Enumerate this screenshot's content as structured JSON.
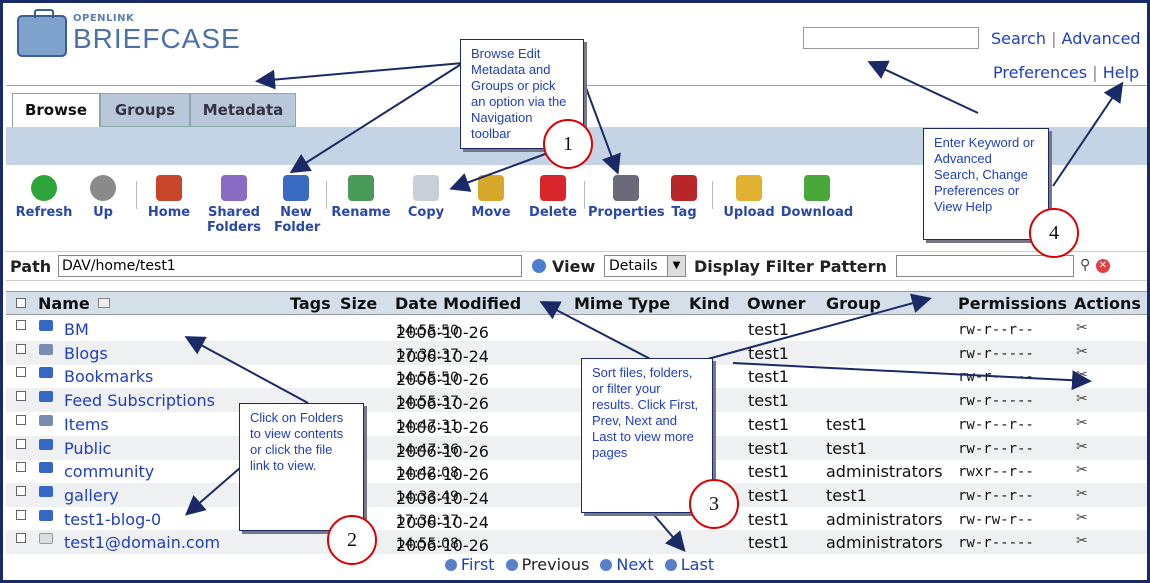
{
  "logo": {
    "line1": "OPENLINK",
    "line2": "BRIEFCASE"
  },
  "top_links": {
    "search": "Search",
    "sep": "|",
    "advanced": "Advanced",
    "preferences": "Preferences",
    "help": "Help"
  },
  "tabs": [
    {
      "label": "Browse"
    },
    {
      "label": "Groups"
    },
    {
      "label": "Metadata"
    }
  ],
  "toolbar": [
    {
      "label": "Refresh",
      "color": "#2ea53a"
    },
    {
      "label": "Up",
      "color": "#8a8a8a"
    },
    {
      "label": "Home",
      "color": "#c8452a"
    },
    {
      "label": "Shared\nFolders",
      "color": "#8b6cc4"
    },
    {
      "label": "New\nFolder",
      "color": "#3a6ac0"
    },
    {
      "label": "Rename",
      "color": "#4a9a5a"
    },
    {
      "label": "Copy",
      "color": "#c9cfd8"
    },
    {
      "label": "Move",
      "color": "#d8a82a"
    },
    {
      "label": "Delete",
      "color": "#d8262a"
    },
    {
      "label": "Properties",
      "color": "#6a6a7a"
    },
    {
      "label": "Tag",
      "color": "#b8262a"
    },
    {
      "label": "Upload",
      "color": "#e0b030"
    },
    {
      "label": "Download",
      "color": "#4aa83a"
    }
  ],
  "pathbar": {
    "path_label": "Path",
    "path_value": "DAV/home/test1",
    "view_label": "View",
    "view_value": "Details",
    "filter_label": "Display Filter Pattern"
  },
  "table": {
    "headers": [
      "Name",
      "Tags",
      "Size",
      "Date Modified",
      "Mime Type",
      "Kind",
      "Owner",
      "Group",
      "Permissions",
      "Actions"
    ],
    "rows": [
      {
        "name": "BM",
        "date": "2006-10-26",
        "time": "14:55:50",
        "owner": "test1",
        "group": "",
        "perm": "rw-r--r--",
        "icon": "folder"
      },
      {
        "name": "Blogs",
        "date": "2006-10-24",
        "time": "17:30:37",
        "owner": "test1",
        "group": "",
        "perm": "rw-r-----",
        "icon": "img"
      },
      {
        "name": "Bookmarks",
        "date": "2006-10-26",
        "time": "14:55:50",
        "owner": "test1",
        "group": "",
        "perm": "rw-r-----",
        "icon": "folder"
      },
      {
        "name": "Feed Subscriptions",
        "date": "2006-10-26",
        "time": "14:55:37",
        "owner": "test1",
        "group": "",
        "perm": "rw-r-----",
        "icon": "folder"
      },
      {
        "name": "Items",
        "date": "2006-10-26",
        "time": "14:47:31",
        "owner": "test1",
        "group": "test1",
        "perm": "rw-r--r--",
        "icon": "img"
      },
      {
        "name": "Public",
        "date": "2006-10-26",
        "time": "14:47:36",
        "owner": "test1",
        "group": "test1",
        "perm": "rw-r--r--",
        "icon": "folder"
      },
      {
        "name": "community",
        "date": "2006-10-26",
        "time": "14:42:08",
        "owner": "test1",
        "group": "administrators",
        "perm": "rwxr--r--",
        "icon": "folder"
      },
      {
        "name": "gallery",
        "date": "2006-10-24",
        "time": "14:33:49",
        "owner": "test1",
        "group": "test1",
        "perm": "rw-r--r--",
        "icon": "folder"
      },
      {
        "name": "test1-blog-0",
        "date": "2006-10-24",
        "time": "17:30:37",
        "owner": "test1",
        "group": "administrators",
        "perm": "rw-rw-r--",
        "icon": "folder"
      },
      {
        "name": "test1@domain.com",
        "date": "2006-10-26",
        "time": "14:55:08",
        "owner": "test1",
        "group": "administrators",
        "perm": "rw-r-----",
        "icon": "doc"
      }
    ]
  },
  "pager": {
    "first": "First",
    "previous": "Previous",
    "next": "Next",
    "last": "Last"
  },
  "callouts": {
    "c1": "Browse Edit Metadata and Groups or pick an option via the Navigation toolbar",
    "c2": "Click on Folders to view contents or click the file link to view.",
    "c3": "Sort files, folders, or filter your results. Click First, Prev, Next and Last to view more pages",
    "c4": "Enter Keyword or Advanced Search, Change Preferences or View Help"
  },
  "numbers": {
    "n1": "1",
    "n2": "2",
    "n3": "3",
    "n4": "4"
  }
}
